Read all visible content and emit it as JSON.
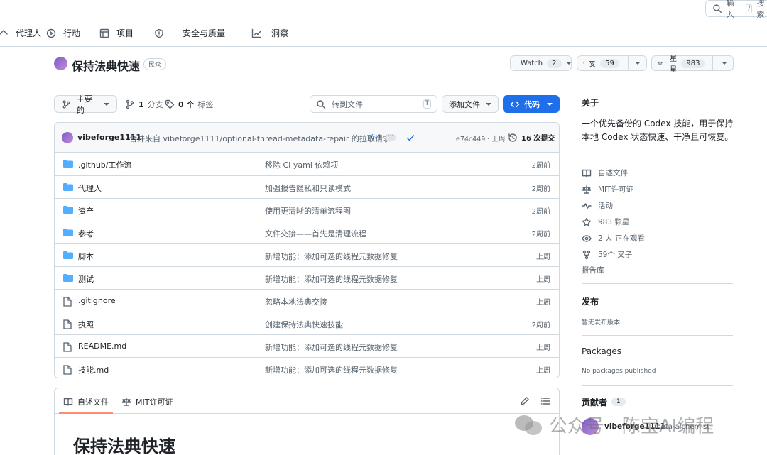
{
  "nav": {
    "items": [
      {
        "label": "代理人"
      },
      {
        "label": "行动"
      },
      {
        "label": "项目"
      },
      {
        "label": "安全与质量"
      },
      {
        "label": "洞察"
      }
    ],
    "search_label": "输入",
    "search_key": "/",
    "search_suffix": "搜索"
  },
  "repo": {
    "name": "保持法典快速",
    "visibility": "民众",
    "watch_label": "Watch",
    "watch_count": "2",
    "fork_label": "叉",
    "fork_count": "59",
    "star_label": "星星",
    "star_count": "983"
  },
  "toolbar": {
    "branch_label": "主要的",
    "branches_count": "1",
    "branches_label": "分支",
    "tags_count": "0 个",
    "tags_label": "标签",
    "goto_placeholder": "转到文件",
    "goto_key": "T",
    "add_file_label": "添加文件",
    "code_label": "代码"
  },
  "commit": {
    "author": "vibeforge1111",
    "message": "合并来自 vibeforge1111/optional-thread-metadata-repair 的拉取请求",
    "pr": "#4",
    "hash": "e74c449 · 上周",
    "commits_label": "16 次提交"
  },
  "files": [
    {
      "name": ".github/工作流",
      "type": "folder",
      "message": "移除 CI yaml 依赖项",
      "time": "2周前"
    },
    {
      "name": "代理人",
      "type": "folder",
      "message": "加强报告隐私和只读模式",
      "time": "2周前"
    },
    {
      "name": "资产",
      "type": "folder",
      "message": "使用更清晰的清单流程图",
      "time": "2周前"
    },
    {
      "name": "参考",
      "type": "folder",
      "message": "文件交接——首先是清理流程",
      "time": "2周前"
    },
    {
      "name": "脚本",
      "type": "folder",
      "message": "新增功能：添加可选的线程元数据修复",
      "time": "上周"
    },
    {
      "name": "测试",
      "type": "folder",
      "message": "新增功能：添加可选的线程元数据修复",
      "time": "上周"
    },
    {
      "name": ".gitignore",
      "type": "file",
      "message": "忽略本地法典交接",
      "time": "上周"
    },
    {
      "name": "执照",
      "type": "file",
      "message": "创建保持法典快速技能",
      "time": "2周前"
    },
    {
      "name": "README.md",
      "type": "file",
      "message": "新增功能：添加可选的线程元数据修复",
      "time": "上周"
    },
    {
      "name": "技能.md",
      "type": "file",
      "message": "新增功能：添加可选的线程元数据修复",
      "time": "上周"
    }
  ],
  "readme": {
    "tab_readme": "自述文件",
    "tab_license": "MIT许可证",
    "heading": "保持法典快速"
  },
  "about": {
    "title": "关于",
    "description": "一个优先备份的 Codex 技能，用于保持本地 Codex 状态快速、干净且可恢复。",
    "links": [
      {
        "label": "自述文件",
        "icon": "book-icon"
      },
      {
        "label": "MIT许可证",
        "icon": "law-icon"
      },
      {
        "label": "活动",
        "icon": "pulse-icon"
      },
      {
        "label": "983 颗星",
        "icon": "star-icon"
      },
      {
        "label": "2 人 正在观看",
        "icon": "eye-icon"
      },
      {
        "label": "59个 叉子",
        "icon": "fork-icon"
      }
    ],
    "report": "报告库"
  },
  "releases": {
    "title": "发布",
    "empty": "暂无发布版本"
  },
  "packages": {
    "title": "Packages",
    "empty": "No packages published"
  },
  "contributors": {
    "title": "贡献者",
    "count": "1",
    "user": "vibeforge1111",
    "handle": "meta-alchemist"
  },
  "watermark": "公众号 · 陈宝AI编程",
  "colors": {
    "accent": "#1f6feb",
    "folder": "#54aeff",
    "border": "#d1d9e0"
  }
}
